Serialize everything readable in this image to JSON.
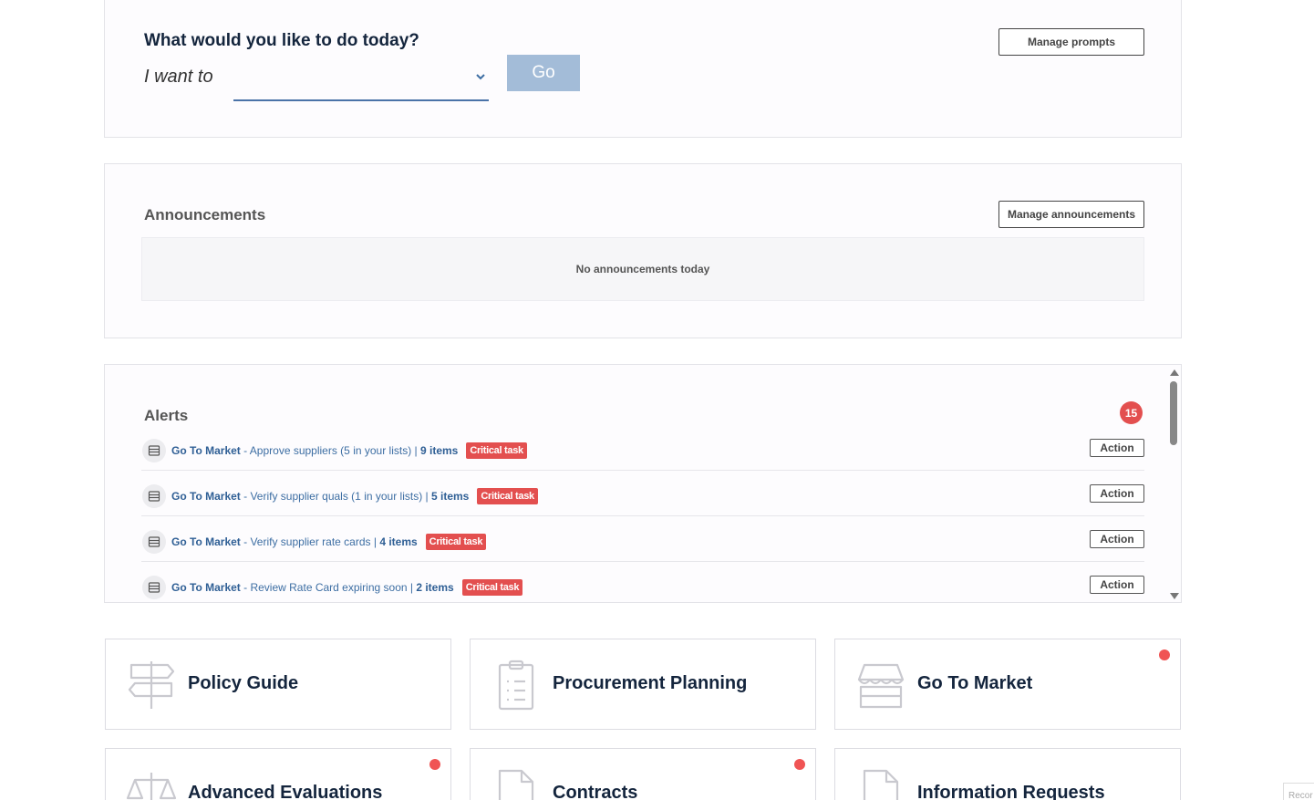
{
  "prompt": {
    "title": "What would you like to do today?",
    "i_want_to": "I want to",
    "select_value": "",
    "go_label": "Go",
    "manage_label": "Manage prompts"
  },
  "announcements": {
    "title": "Announcements",
    "manage_label": "Manage announcements",
    "empty_text": "No announcements today"
  },
  "alerts": {
    "title": "Alerts",
    "count": "15",
    "rows": [
      {
        "module": "Go To Market",
        "text": " - Approve suppliers (5 in your lists) | ",
        "items": "9 items",
        "tag": "Critical task",
        "action": "Action"
      },
      {
        "module": "Go To Market",
        "text": " - Verify supplier quals (1 in your lists) | ",
        "items": "5 items",
        "tag": "Critical task",
        "action": "Action"
      },
      {
        "module": "Go To Market",
        "text": " - Verify supplier rate cards | ",
        "items": "4 items",
        "tag": "Critical task",
        "action": "Action"
      },
      {
        "module": "Go To Market",
        "text": " - Review Rate Card expiring soon | ",
        "items": "2 items",
        "tag": "Critical task",
        "action": "Action"
      }
    ]
  },
  "tiles": [
    {
      "label": "Policy Guide",
      "icon": "signpost-icon",
      "notify": false
    },
    {
      "label": "Procurement Planning",
      "icon": "clipboard-list-icon",
      "notify": false
    },
    {
      "label": "Go To Market",
      "icon": "store-icon",
      "notify": true
    },
    {
      "label": "Advanced Evaluations",
      "icon": "scales-icon",
      "notify": true
    },
    {
      "label": "Contracts",
      "icon": "document-icon",
      "notify": true
    },
    {
      "label": "Information Requests",
      "icon": "document-info-icon",
      "notify": false
    }
  ],
  "corner_badge": "Recor",
  "colors": {
    "accent_blue": "#3d6ea3",
    "navy": "#14253d",
    "critical_red": "#e34f4f",
    "go_button": "#a3bcd8"
  }
}
